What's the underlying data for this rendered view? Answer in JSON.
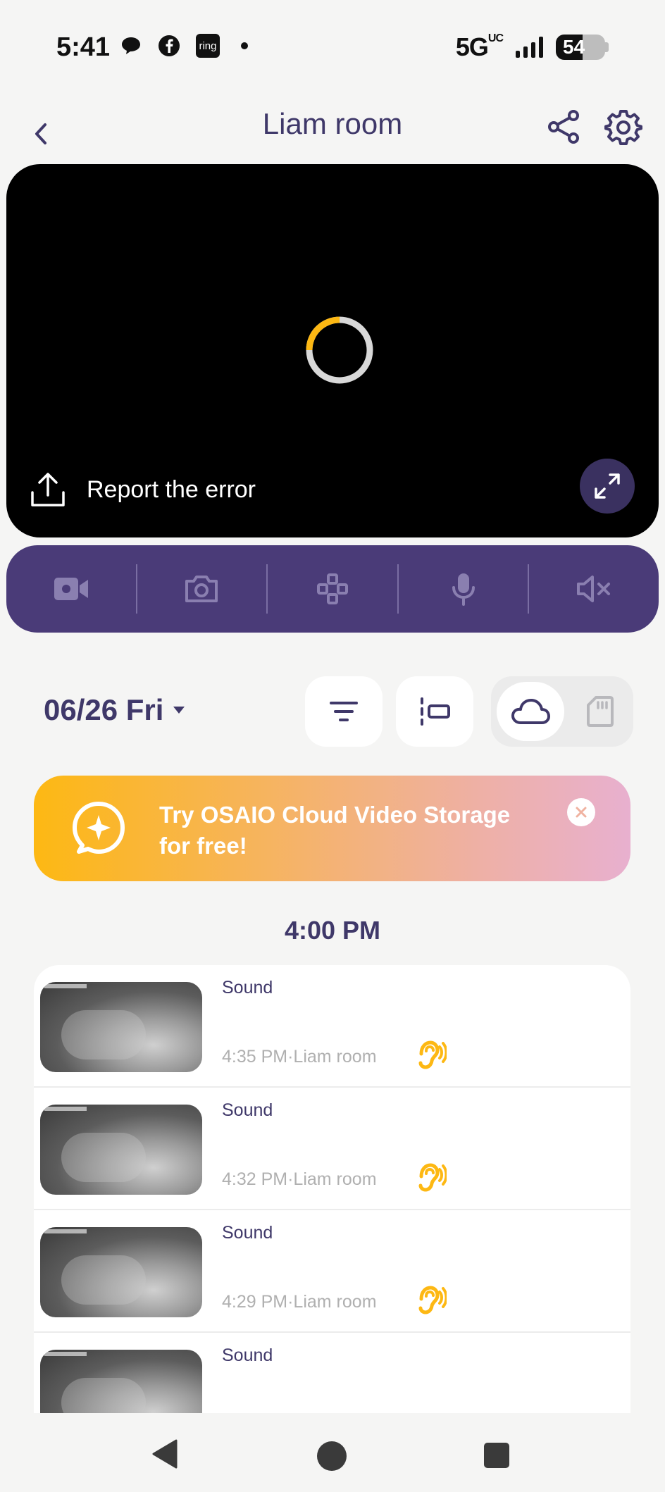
{
  "status_bar": {
    "time": "5:41",
    "ring_label": "ring",
    "network": "5G",
    "network_suffix": "UC",
    "battery_level": "54",
    "battery_fraction": 0.54
  },
  "header": {
    "title": "Liam room"
  },
  "video": {
    "report_label": "Report the error",
    "spinner_progress": 0.25
  },
  "date": {
    "label": "06/26 Fri"
  },
  "banner": {
    "text": "Try OSAIO Cloud Video Storage for free!"
  },
  "timeline": {
    "hour_label": "4:00 PM"
  },
  "events": [
    {
      "type": "Sound",
      "meta": "4:35 PM·Liam room"
    },
    {
      "type": "Sound",
      "meta": "4:32 PM·Liam room"
    },
    {
      "type": "Sound",
      "meta": "4:29 PM·Liam room"
    },
    {
      "type": "Sound",
      "meta": ""
    }
  ],
  "colors": {
    "primary": "#4a3b78",
    "text": "#3f3869",
    "accent": "#fdb813",
    "background": "#f5f5f4"
  },
  "icons": {
    "controls": [
      "record-video-icon",
      "snapshot-icon",
      "ptz-control-icon",
      "microphone-icon",
      "mute-icon"
    ]
  }
}
